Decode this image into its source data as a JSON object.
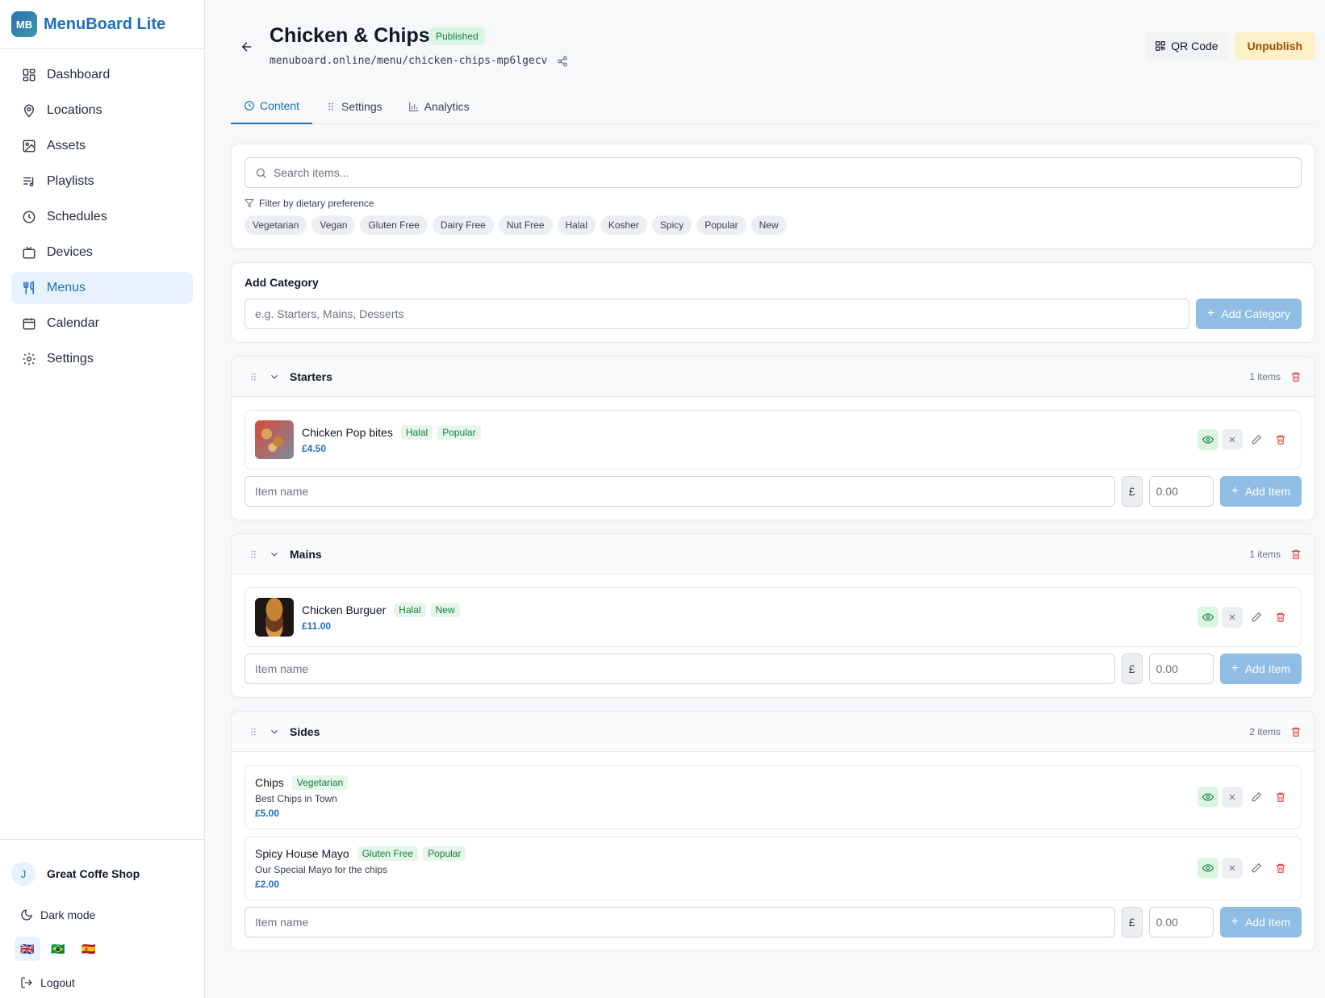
{
  "sidebar": {
    "brand_initials": "MB",
    "brand_name": "MenuBoard Lite",
    "items": [
      {
        "label": "Dashboard",
        "icon": "grid-icon"
      },
      {
        "label": "Locations",
        "icon": "map-pin-icon"
      },
      {
        "label": "Assets",
        "icon": "image-icon"
      },
      {
        "label": "Playlists",
        "icon": "playlist-icon"
      },
      {
        "label": "Schedules",
        "icon": "clock-icon"
      },
      {
        "label": "Devices",
        "icon": "tv-icon"
      },
      {
        "label": "Menus",
        "icon": "utensils-icon",
        "active": true
      },
      {
        "label": "Calendar",
        "icon": "calendar-icon"
      },
      {
        "label": "Settings",
        "icon": "gear-icon"
      }
    ],
    "user_initial": "J",
    "user_name": "Great Coffe Shop",
    "dark_mode": "Dark mode",
    "flags": [
      "🇬🇧",
      "🇧🇷",
      "🇪🇸"
    ],
    "logout": "Logout"
  },
  "header": {
    "title": "Chicken & Chips",
    "status": "Published",
    "url": "menuboard.online/menu/chicken-chips-mp6lgecv",
    "qr_label": "QR Code",
    "unpublish_label": "Unpublish"
  },
  "tabs": [
    {
      "label": "Content",
      "active": true
    },
    {
      "label": "Settings"
    },
    {
      "label": "Analytics"
    }
  ],
  "search": {
    "placeholder": "Search items...",
    "filter_label": "Filter by dietary preference",
    "chips": [
      "Vegetarian",
      "Vegan",
      "Gluten Free",
      "Dairy Free",
      "Nut Free",
      "Halal",
      "Kosher",
      "Spicy",
      "Popular",
      "New"
    ]
  },
  "add_category": {
    "title": "Add Category",
    "placeholder": "e.g. Starters, Mains, Desserts",
    "button": "Add Category"
  },
  "add_item": {
    "name_placeholder": "Item name",
    "currency": "£",
    "price_placeholder": "0.00",
    "button": "Add Item"
  },
  "categories": [
    {
      "name": "Starters",
      "count": "1 items",
      "items": [
        {
          "name": "Chicken Pop bites",
          "tags": [
            "Halal",
            "Popular"
          ],
          "price": "£4.50",
          "thumb": "pop"
        }
      ]
    },
    {
      "name": "Mains",
      "count": "1 items",
      "items": [
        {
          "name": "Chicken Burguer",
          "tags": [
            "Halal",
            "New"
          ],
          "price": "£11.00",
          "thumb": "burger"
        }
      ]
    },
    {
      "name": "Sides",
      "count": "2 items",
      "items": [
        {
          "name": "Chips",
          "tags": [
            "Vegetarian"
          ],
          "desc": "Best Chips in Town",
          "price": "£5.00"
        },
        {
          "name": "Spicy House Mayo",
          "tags": [
            "Gluten Free",
            "Popular"
          ],
          "desc": "Our Special Mayo for the chips",
          "price": "£2.00"
        }
      ]
    }
  ]
}
